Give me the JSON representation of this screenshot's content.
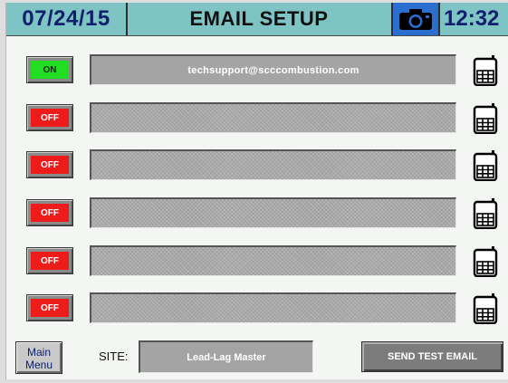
{
  "header": {
    "date": "07/24/15",
    "title": "EMAIL SETUP",
    "time": "12:32",
    "camera_icon": "camera-icon"
  },
  "recipients": [
    {
      "status": "ON",
      "email": ""
    },
    {
      "status": "OFF",
      "email": ""
    },
    {
      "status": "OFF",
      "email": ""
    },
    {
      "status": "OFF",
      "email": ""
    },
    {
      "status": "OFF",
      "email": ""
    },
    {
      "status": "OFF",
      "email": ""
    }
  ],
  "first_email": "techsupport@scccombustion.com",
  "phone_icon": "mobile-phone-icon",
  "footer": {
    "main_menu_line1": "Main",
    "main_menu_line2": "Menu",
    "site_label": "SITE:",
    "site_value": "Lead-Lag Master",
    "send_test_label": "SEND TEST EMAIL"
  },
  "colors": {
    "header_bg": "#7fc4c4",
    "on_green": "#22dd22",
    "off_red": "#ee1b1b",
    "camera_bg": "#2a6fcf",
    "header_text": "#10206c"
  }
}
